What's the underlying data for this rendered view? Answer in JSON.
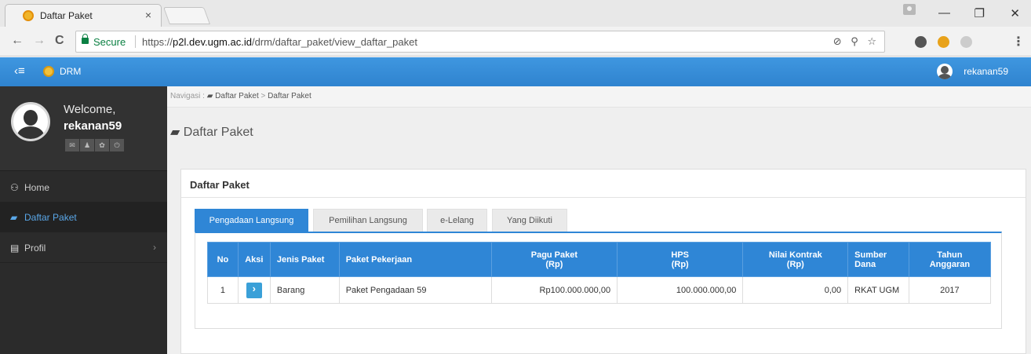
{
  "browser": {
    "tab_title": "Daftar Paket",
    "tab_close": "×",
    "secure_label": "Secure",
    "url_scheme": "https://",
    "url_host": "p2l.dev.ugm.ac.id",
    "url_path": "/drm/daftar_paket/view_daftar_paket",
    "back": "←",
    "forward": "→",
    "reload": "C",
    "omni_icons": "⊘ ⚲ ☆",
    "minimize": "—",
    "restore": "❐",
    "close": "✕",
    "menu": "⋮"
  },
  "app": {
    "menu_icon": "‹≡",
    "brand": "DRM",
    "user": "rekanan59"
  },
  "sidebar": {
    "welcome": "Welcome,",
    "username": "rekanan59",
    "actions": [
      "✉",
      "♟",
      "✿",
      "⏻"
    ],
    "items": [
      {
        "icon": "⚇",
        "label": "Home"
      },
      {
        "icon": "▰",
        "label": "Daftar Paket"
      },
      {
        "icon": "▤",
        "label": "Profil",
        "chevron": "›"
      }
    ]
  },
  "breadcrumb": {
    "prefix": "Navigasi :",
    "item1": "Daftar Paket",
    "separator": ">",
    "item2": "Daftar Paket"
  },
  "page": {
    "title": "Daftar Paket",
    "title_icon": "▰"
  },
  "panel": {
    "heading": "Daftar Paket",
    "tabs": [
      "Pengadaan Langsung",
      "Pemilihan Langsung",
      "e-Lelang",
      "Yang Diikuti"
    ],
    "columns": {
      "no": "No",
      "aksi": "Aksi",
      "jenis": "Jenis Paket",
      "paket": "Paket Pekerjaan",
      "pagu_1": "Pagu Paket",
      "pagu_2": "(Rp)",
      "hps_1": "HPS",
      "hps_2": "(Rp)",
      "nilai_1": "Nilai Kontrak",
      "nilai_2": "(Rp)",
      "sumber_1": "Sumber",
      "sumber_2": "Dana",
      "tahun_1": "Tahun",
      "tahun_2": "Anggaran"
    },
    "rows": [
      {
        "no": "1",
        "jenis": "Barang",
        "paket": "Paket Pengadaan 59",
        "pagu": "Rp100.000.000,00",
        "hps": "100.000.000,00",
        "nilai": "0,00",
        "sumber": "RKAT UGM",
        "tahun": "2017"
      }
    ]
  }
}
